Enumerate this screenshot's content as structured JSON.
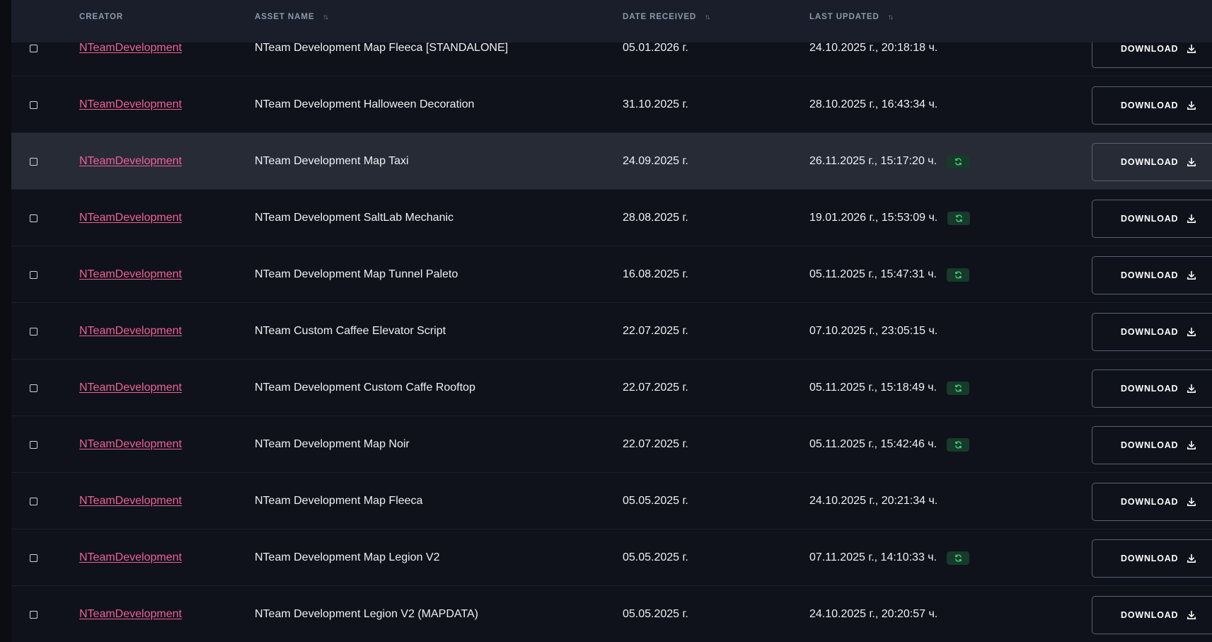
{
  "table": {
    "headers": {
      "creator": "CREATOR",
      "asset_name": "ASSET NAME",
      "date_received": "DATE RECEIVED",
      "last_updated": "LAST UPDATED"
    },
    "download_label": "DOWNLOAD",
    "accent_colors": {
      "creator_link": "#f0619b",
      "update_badge_bg": "#173a2a",
      "update_badge_icon": "#3ddc84"
    },
    "rows": [
      {
        "creator": "NTeamDevelopment",
        "asset": "NTeam Development Map Fleeca [STANDALONE]",
        "received": "05.01.2026 г.",
        "updated": "24.10.2025 г., 20:18:18 ч.",
        "has_update": false,
        "highlight": false
      },
      {
        "creator": "NTeamDevelopment",
        "asset": "NTeam Development Halloween Decoration",
        "received": "31.10.2025 г.",
        "updated": "28.10.2025 г., 16:43:34 ч.",
        "has_update": false,
        "highlight": false
      },
      {
        "creator": "NTeamDevelopment",
        "asset": "NTeam Development Map Taxi",
        "received": "24.09.2025 г.",
        "updated": "26.11.2025 г., 15:17:20 ч.",
        "has_update": true,
        "highlight": true
      },
      {
        "creator": "NTeamDevelopment",
        "asset": "NTeam Development SaltLab Mechanic",
        "received": "28.08.2025 г.",
        "updated": "19.01.2026 г., 15:53:09 ч.",
        "has_update": true,
        "highlight": false
      },
      {
        "creator": "NTeamDevelopment",
        "asset": "NTeam Development Map Tunnel Paleto",
        "received": "16.08.2025 г.",
        "updated": "05.11.2025 г., 15:47:31 ч.",
        "has_update": true,
        "highlight": false
      },
      {
        "creator": "NTeamDevelopment",
        "asset": "NTeam Custom Caffee Elevator Script",
        "received": "22.07.2025 г.",
        "updated": "07.10.2025 г., 23:05:15 ч.",
        "has_update": false,
        "highlight": false
      },
      {
        "creator": "NTeamDevelopment",
        "asset": "NTeam Development Custom Caffe Rooftop",
        "received": "22.07.2025 г.",
        "updated": "05.11.2025 г., 15:18:49 ч.",
        "has_update": true,
        "highlight": false
      },
      {
        "creator": "NTeamDevelopment",
        "asset": "NTeam Development Map Noir",
        "received": "22.07.2025 г.",
        "updated": "05.11.2025 г., 15:42:46 ч.",
        "has_update": true,
        "highlight": false
      },
      {
        "creator": "NTeamDevelopment",
        "asset": "NTeam Development Map Fleeca",
        "received": "05.05.2025 г.",
        "updated": "24.10.2025 г., 20:21:34 ч.",
        "has_update": false,
        "highlight": false
      },
      {
        "creator": "NTeamDevelopment",
        "asset": "NTeam Development Map Legion V2",
        "received": "05.05.2025 г.",
        "updated": "07.11.2025 г., 14:10:33 ч.",
        "has_update": true,
        "highlight": false
      },
      {
        "creator": "NTeamDevelopment",
        "asset": "NTeam Development Legion V2 (MAPDATA)",
        "received": "05.05.2025 г.",
        "updated": "24.10.2025 г., 20:20:57 ч.",
        "has_update": false,
        "highlight": false
      }
    ]
  }
}
